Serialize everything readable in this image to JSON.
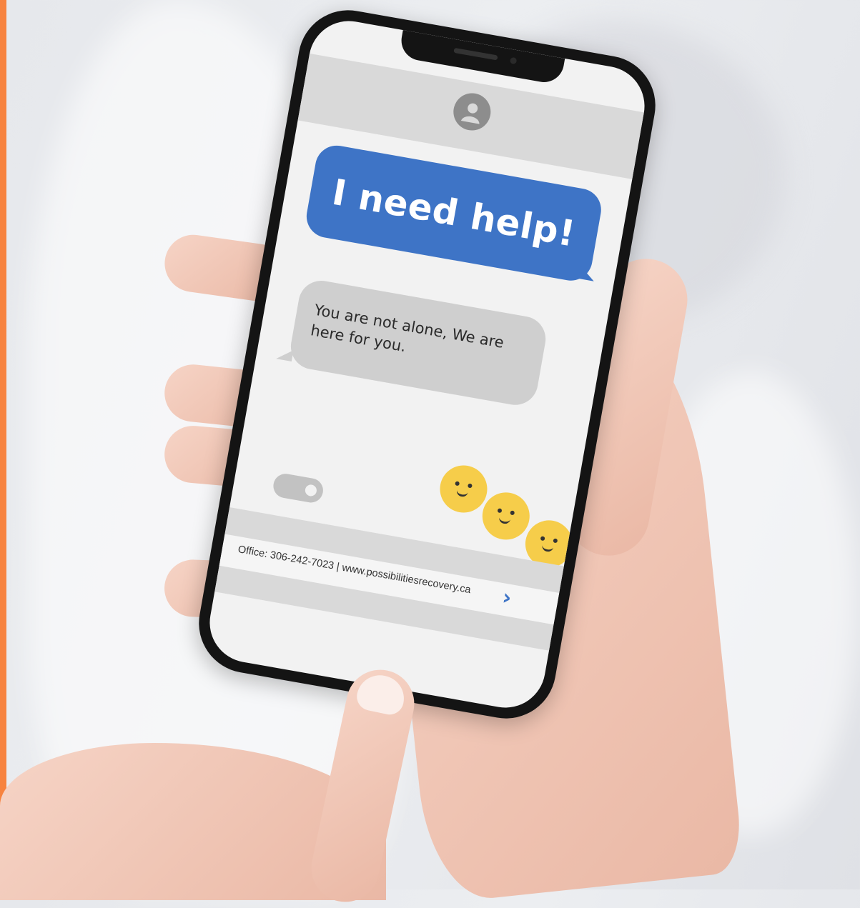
{
  "messages": {
    "sent": "I need help!",
    "received": "You are not alone, We are here for you."
  },
  "footer": {
    "contact": "Office: 306-242-7023 | www.possibilitiesrecovery.ca",
    "next_symbol": "›"
  },
  "icons": {
    "avatar": "user-silhouette-icon",
    "emoji": "smiley-face-icon",
    "typing": "typing-indicator-icon",
    "next": "chevron-right-icon"
  },
  "colors": {
    "accent": "#f7833f",
    "sent_bubble": "#3e74c6",
    "received_bubble": "#cfcfcf",
    "emoji": "#f6cd4a"
  }
}
